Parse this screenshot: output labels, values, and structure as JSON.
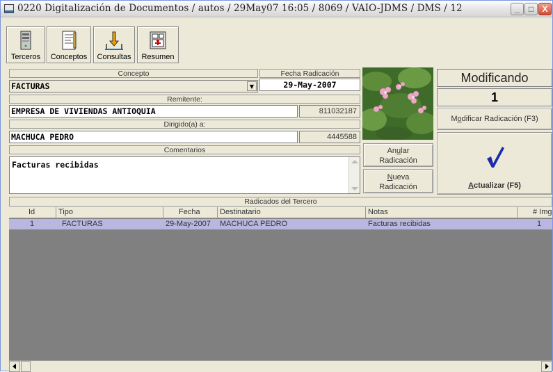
{
  "window": {
    "title": "0220 Digitalización de Documentos / autos / 29May07 16:05 / 8069 / VAIO-JDMS / DMS / 12",
    "buttons": {
      "minimize": "_",
      "maximize": "□",
      "close": "X"
    }
  },
  "toolbar": {
    "items": [
      {
        "label": "Terceros",
        "icon": "server-icon"
      },
      {
        "label": "Conceptos",
        "icon": "document-icon"
      },
      {
        "label": "Consultas",
        "icon": "inbox-icon"
      },
      {
        "label": "Resumen",
        "icon": "calculator-icon"
      }
    ]
  },
  "form": {
    "concepto_label": "Concepto",
    "concepto_value": "FACTURAS",
    "fecha_label": "Fecha Radicación",
    "fecha_value": "29-May-2007",
    "remitente_label": "Remitente:",
    "remitente_value": "EMPRESA  DE VIVIENDAS ANTIOQUIA",
    "remitente_id": "811032187",
    "dirigido_label": "Dirigido(a) a:",
    "dirigido_value": "MACHUCA PEDRO",
    "dirigido_id": "4445588",
    "comentarios_label": "Comentarios",
    "comentarios_value": "Facturas recibidas"
  },
  "status": {
    "mode": "Modificando",
    "count": "1"
  },
  "actions": {
    "modificar_pre": "M",
    "modificar_ul": "o",
    "modificar_post": "dificar Radicación (F3)",
    "anular_pre": "An",
    "anular_ul": "u",
    "anular_post": "lar",
    "anular_line2": "Radicación",
    "nueva_ul": "N",
    "nueva_post": "ueva",
    "nueva_line2": "Radicación",
    "actualizar_ul": "A",
    "actualizar_post": "ctualizar (F5)"
  },
  "grid": {
    "title": "Radicados del Tercero",
    "columns": [
      "Id",
      "Tipo",
      "Fecha",
      "Destinatario",
      "Notas",
      "# Img"
    ],
    "rows": [
      {
        "id": "1",
        "tipo": "FACTURAS",
        "fecha": "29-May-2007",
        "destinatario": "MACHUCA PEDRO",
        "notas": "Facturas recibidas",
        "img": "1"
      }
    ]
  },
  "colors": {
    "selected_row": "#b9b7df",
    "grid_bg": "#808080",
    "check_mark": "#1a2bb0"
  }
}
